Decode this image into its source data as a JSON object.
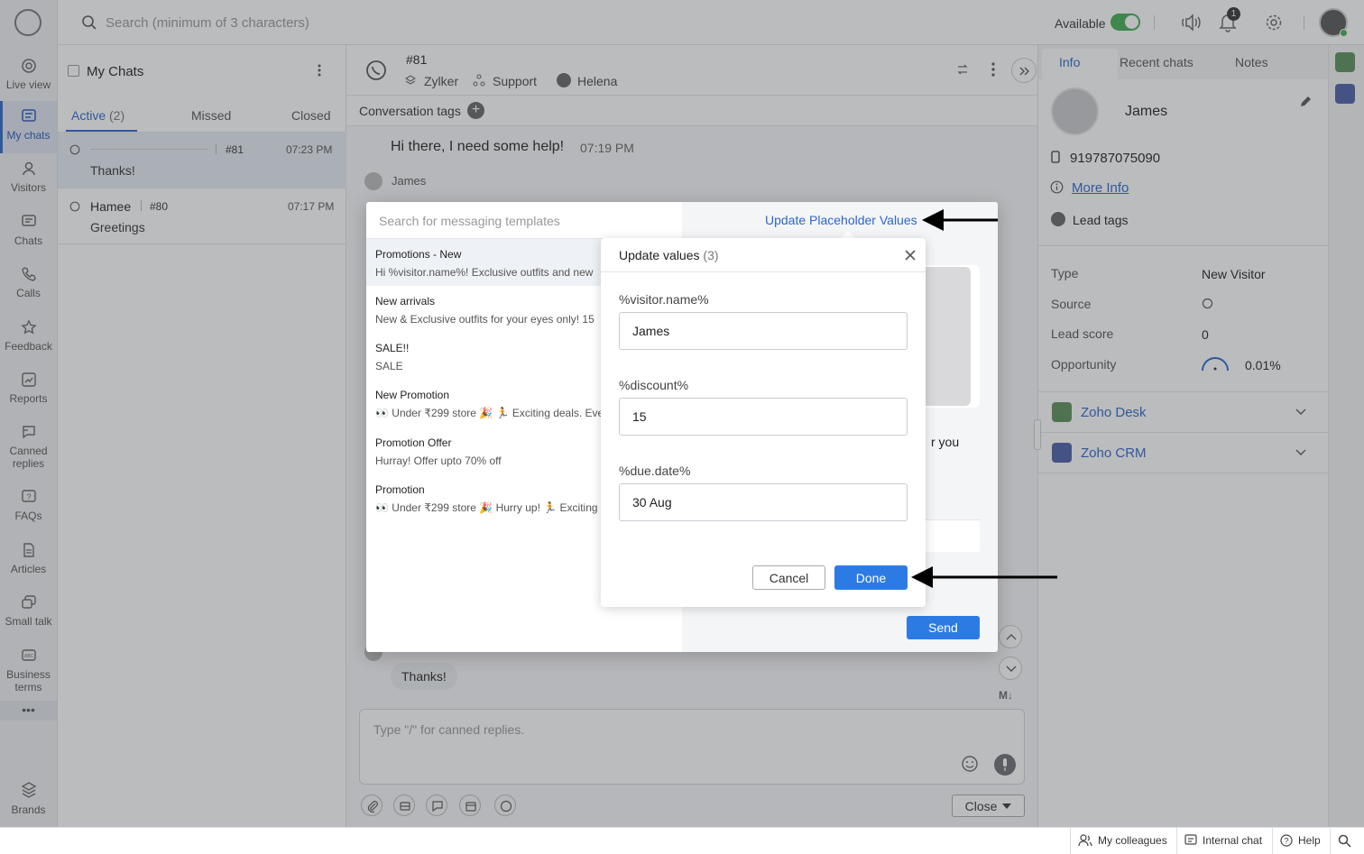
{
  "topbar": {
    "search_placeholder": "Search (minimum of 3 characters)",
    "status_label": "Available",
    "notification_count": "1"
  },
  "nav": {
    "items": [
      {
        "label": "Live view",
        "icon": "live-view-icon"
      },
      {
        "label": "My chats",
        "icon": "my-chats-icon"
      },
      {
        "label": "Visitors",
        "icon": "visitors-icon"
      },
      {
        "label": "Chats",
        "icon": "chats-icon"
      },
      {
        "label": "Calls",
        "icon": "phone-icon"
      },
      {
        "label": "Feedback",
        "icon": "star-icon"
      },
      {
        "label": "Reports",
        "icon": "reports-icon"
      },
      {
        "label": "Canned replies",
        "icon": "canned-replies-icon"
      },
      {
        "label": "FAQs",
        "icon": "faq-icon"
      },
      {
        "label": "Articles",
        "icon": "articles-icon"
      },
      {
        "label": "Small talk",
        "icon": "small-talk-icon"
      },
      {
        "label": "Business terms",
        "icon": "business-terms-icon"
      }
    ],
    "more": "•••",
    "brands": "Brands"
  },
  "chatlist": {
    "title": "My Chats",
    "tabs": {
      "active": "Active",
      "active_count": "(2)",
      "missed": "Missed",
      "closed": "Closed"
    },
    "rows": [
      {
        "name": "",
        "id": "#81",
        "time": "07:23 PM",
        "preview": "Thanks!"
      },
      {
        "name": "Hamee",
        "id": "#80",
        "time": "07:17 PM",
        "preview": "Greetings"
      }
    ]
  },
  "conversation": {
    "id": "#81",
    "brand": "Zylker",
    "department": "Support",
    "agent": "Helena",
    "tags_label": "Conversation tags",
    "first_message": "Hi there, I need some help!",
    "first_time": "07:19 PM",
    "sender": "James",
    "last_message": "Thanks!",
    "composer_placeholder": "Type \"/\" for canned replies.",
    "md_label": "M↓",
    "close_label": "Close"
  },
  "rpanel": {
    "tabs": [
      "Info",
      "Recent chats",
      "Notes"
    ],
    "name": "James",
    "phone": "919787075090",
    "more_info": "More Info",
    "lead_tags": "Lead tags",
    "fields": [
      {
        "label": "Type",
        "value": "New Visitor"
      },
      {
        "label": "Source",
        "value": ""
      },
      {
        "label": "Lead score",
        "value": "0"
      },
      {
        "label": "Opportunity",
        "value": "0.01%"
      }
    ],
    "integrations": [
      "Zoho Desk",
      "Zoho CRM"
    ]
  },
  "bottombar": {
    "colleagues": "My colleagues",
    "internal_chat": "Internal chat",
    "help": "Help"
  },
  "template_modal": {
    "search_placeholder": "Search for messaging templates",
    "update_link": "Update Placeholder Values",
    "templates": [
      {
        "title": "Promotions - New",
        "body": "Hi %visitor.name%! Exclusive outfits and new"
      },
      {
        "title": "New arrivals",
        "body": "New & Exclusive outfits for your eyes only! 15"
      },
      {
        "title": "SALE!!",
        "body": "SALE"
      },
      {
        "title": "New Promotion",
        "body": "👀 Under ₹299 store 🎉 🏃 Exciting deals. Ever"
      },
      {
        "title": "Promotion Offer",
        "body": "Hurray! Offer upto 70% off"
      },
      {
        "title": "Promotion",
        "body": "👀 Under ₹299 store 🎉 Hurry up! 🏃 Exciting d"
      }
    ],
    "preview_text_fragment": "r you",
    "send_label": "Send"
  },
  "update_dialog": {
    "title": "Update values",
    "count": "(3)",
    "fields": [
      {
        "label": "%visitor.name%",
        "value": "James"
      },
      {
        "label": "%discount%",
        "value": "15"
      },
      {
        "label": "%due.date%",
        "value": "30 Aug"
      }
    ],
    "cancel_label": "Cancel",
    "done_label": "Done"
  },
  "colors": {
    "accent": "#2c66d0",
    "button_blue": "#2c7be5",
    "available_green": "#3fae54"
  }
}
